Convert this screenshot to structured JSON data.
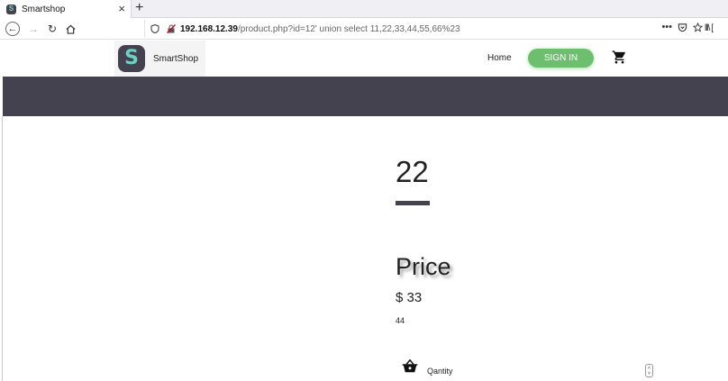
{
  "browser": {
    "tab_title": "Smartshop",
    "tab_favicon_letter": "S",
    "tab_close": "×",
    "new_tab": "+",
    "url_host": "192.168.12.39",
    "url_path": "/product.php?id=12' union select 11,22,33,44,55,66%23",
    "url_actions": [
      "•••",
      "pocket-icon",
      "star-icon"
    ],
    "right_tools": "lll\\ ["
  },
  "site": {
    "logo_letter": "S",
    "brand_name": "SmartShop",
    "nav_home": "Home",
    "signin_label": "SIGN IN",
    "colors": {
      "accent_dark": "#45424f",
      "signin_green": "#6dbf6f",
      "logo_teal": "#6dd0c4"
    }
  },
  "product": {
    "title": "22",
    "price_heading": "Price",
    "price_value": "$ 33",
    "extra": "44",
    "quantity_label": "Qantity",
    "stepper_up": "˄",
    "stepper_down": "˅"
  }
}
